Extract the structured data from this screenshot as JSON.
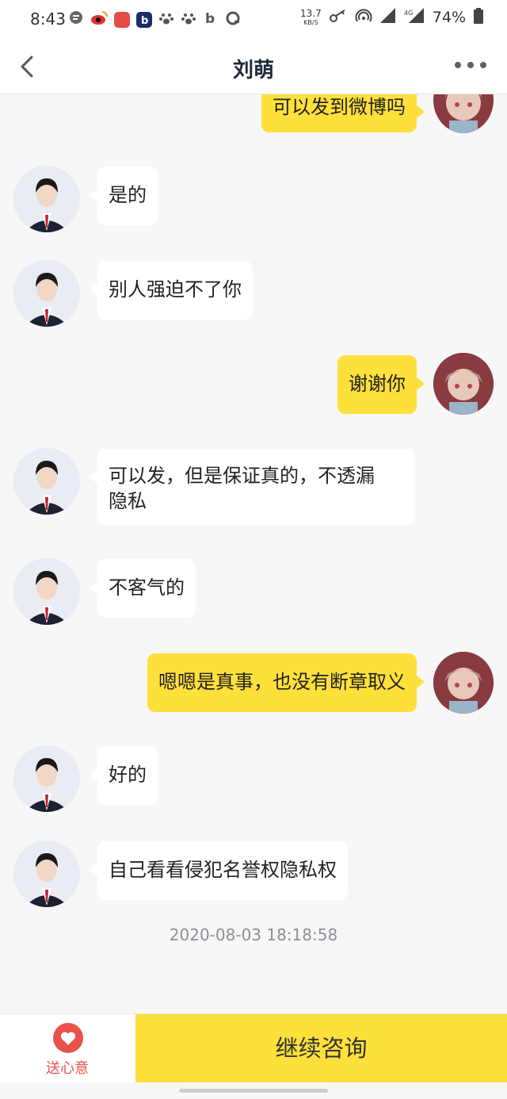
{
  "status_bar": {
    "time": "8:43",
    "net_speed_value": "13.7",
    "net_speed_unit": "KB/S",
    "network": "4G",
    "battery": "74%",
    "icons": [
      "chat-icon",
      "weibo-icon",
      "app-icon",
      "b-app-icon",
      "paw-icon",
      "paw-icon",
      "b-icon",
      "q-icon",
      "key-icon",
      "hotspot-icon",
      "signal-icon",
      "signal-icon",
      "battery-icon"
    ]
  },
  "header": {
    "title": "刘萌",
    "back_icon": "chevron-left-icon",
    "more_icon": "more-dots-icon"
  },
  "messages": [
    {
      "side": "right",
      "text": "可以发到微博吗"
    },
    {
      "side": "left",
      "text": "是的"
    },
    {
      "side": "left",
      "text": "别人强迫不了你"
    },
    {
      "side": "right",
      "text": "谢谢你"
    },
    {
      "side": "left",
      "text_line1": "可以发，但是保证真的，不透漏",
      "text_line2": "隐私"
    },
    {
      "side": "left",
      "text": "不客气的"
    },
    {
      "side": "right",
      "text": "嗯嗯是真事，也没有断章取义"
    },
    {
      "side": "left",
      "text": "好的"
    },
    {
      "side": "left",
      "text": "自己看看侵犯名誉权隐私权"
    }
  ],
  "timestamp": "2020-08-03 18:18:58",
  "bottom": {
    "gift_label": "送心意",
    "continue_label": "继续咨询"
  },
  "colors": {
    "accent_yellow": "#fde03a",
    "gift_red": "#e8524a",
    "background": "#f7f7f7"
  }
}
